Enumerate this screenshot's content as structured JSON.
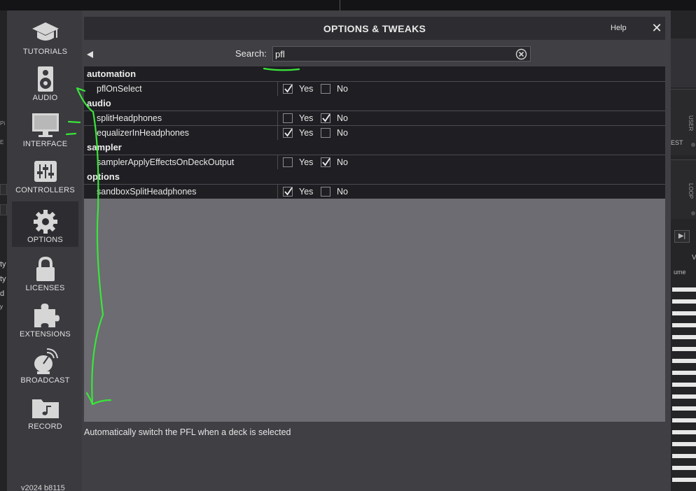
{
  "dialog": {
    "title": "OPTIONS & TWEAKS",
    "help_label": "Help",
    "close_symbol": "✕",
    "version": "v2024 b8115"
  },
  "sidebar": {
    "items": [
      {
        "label": "TUTORIALS",
        "icon": "graduation-cap-icon",
        "active": false
      },
      {
        "label": "AUDIO",
        "icon": "speaker-icon",
        "active": false
      },
      {
        "label": "INTERFACE",
        "icon": "monitor-icon",
        "active": false
      },
      {
        "label": "CONTROLLERS",
        "icon": "mixer-sliders-icon",
        "active": false
      },
      {
        "label": "OPTIONS",
        "icon": "gear-icon",
        "active": true
      },
      {
        "label": "LICENSES",
        "icon": "lock-icon",
        "active": false
      },
      {
        "label": "EXTENSIONS",
        "icon": "puzzle-icon",
        "active": false
      },
      {
        "label": "BROADCAST",
        "icon": "satellite-dish-icon",
        "active": false
      },
      {
        "label": "RECORD",
        "icon": "music-folder-icon",
        "active": false
      }
    ]
  },
  "search": {
    "label": "Search:",
    "value": "pfl"
  },
  "options": {
    "yes_label": "Yes",
    "no_label": "No",
    "groups": [
      {
        "name": "automation",
        "rows": [
          {
            "name": "pflOnSelect",
            "value": "yes"
          }
        ]
      },
      {
        "name": "audio",
        "rows": [
          {
            "name": "splitHeadphones",
            "value": "no"
          },
          {
            "name": "equalizerInHeadphones",
            "value": "yes"
          }
        ]
      },
      {
        "name": "sampler",
        "rows": [
          {
            "name": "samplerApplyEffectsOnDeckOutput",
            "value": "no"
          }
        ]
      },
      {
        "name": "options",
        "rows": [
          {
            "name": "sandboxSplitHeadphones",
            "value": "yes"
          }
        ]
      }
    ]
  },
  "description": "Automatically switch the PFL when a deck is selected",
  "background": {
    "left_fragments": [
      "Pi",
      "E",
      "ty",
      "ty",
      "d",
      "y"
    ],
    "right_labels": {
      "user": "USER",
      "est": "EST",
      "loop": "LOOP",
      "volume": "ume",
      "v": "V"
    }
  },
  "colors": {
    "annotation_marker": "#39e639",
    "panel_background": "#3f3f44",
    "row_background": "#1f1f23"
  }
}
